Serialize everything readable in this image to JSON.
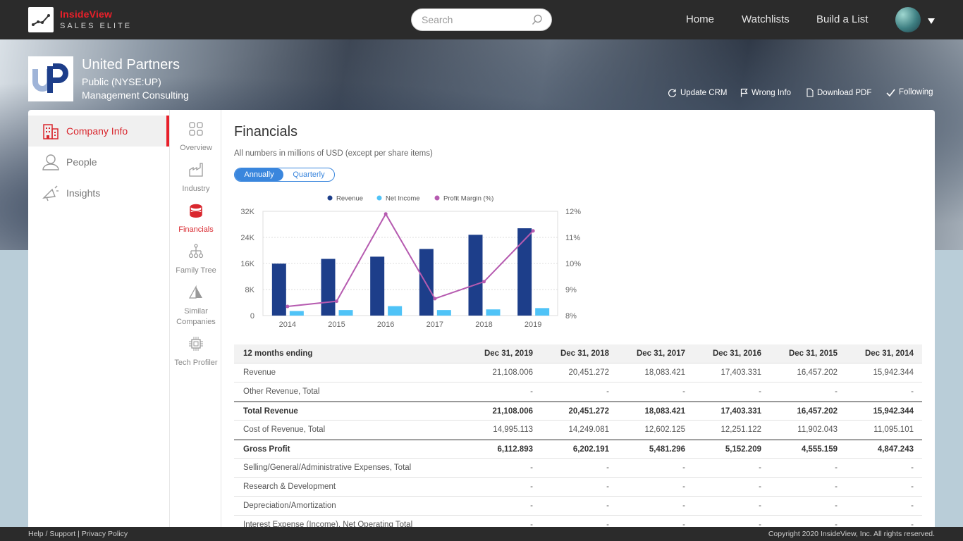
{
  "header": {
    "brand_name": "InsideView",
    "brand_sub": "SALES ELITE",
    "search_placeholder": "Search",
    "nav": [
      "Home",
      "Watchlists",
      "Build a List"
    ]
  },
  "company": {
    "logo_text": "UP",
    "name": "United Partners",
    "listing": "Public (NYSE:UP)",
    "industry": "Management Consulting",
    "actions": [
      "Update CRM",
      "Wrong Info",
      "Download PDF",
      "Following"
    ]
  },
  "left_nav": [
    "Company Info",
    "People",
    "Insights"
  ],
  "sub_nav": [
    "Overview",
    "Industry",
    "Financials",
    "Family Tree",
    "Similar Companies",
    "Tech Profiler"
  ],
  "financials": {
    "title": "Financials",
    "note": "All numbers in millions of USD (except per share items)",
    "toggle": [
      "Annually",
      "Quarterly"
    ],
    "selected": "Annually"
  },
  "chart_data": {
    "type": "bar",
    "categories": [
      "2014",
      "2015",
      "2016",
      "2017",
      "2018",
      "2019"
    ],
    "series": [
      {
        "name": "Revenue",
        "type": "bar",
        "axis": "left",
        "color": "#1d3e8a",
        "values": [
          15942,
          17403,
          18083,
          20451,
          24800,
          26800
        ]
      },
      {
        "name": "Net Income",
        "type": "bar",
        "axis": "left",
        "color": "#4fc3f7",
        "values": [
          1400,
          1700,
          2900,
          1700,
          1900,
          2300
        ]
      },
      {
        "name": "Profit Margin (%)",
        "type": "line",
        "axis": "right",
        "color": "#b65bb0",
        "values": [
          8.35,
          8.55,
          11.9,
          8.65,
          9.3,
          11.25
        ]
      }
    ],
    "y_left": {
      "ticks": [
        "0",
        "8K",
        "16K",
        "24K",
        "32K"
      ],
      "range": [
        0,
        32000
      ]
    },
    "y_right": {
      "ticks": [
        "8%",
        "9%",
        "10%",
        "11%",
        "12%"
      ],
      "range": [
        8,
        12
      ]
    },
    "legend": "top-center",
    "grid": true
  },
  "table": {
    "headers": [
      "12 months ending",
      "Dec 31, 2019",
      "Dec 31, 2018",
      "Dec 31, 2017",
      "Dec 31, 2016",
      "Dec 31, 2015",
      "Dec 31, 2014"
    ],
    "rows": [
      {
        "label": "Revenue",
        "values": [
          "21,108.006",
          "20,451.272",
          "18,083.421",
          "17,403.331",
          "16,457.202",
          "15,942.344"
        ],
        "bold": false
      },
      {
        "label": "Other Revenue, Total",
        "values": [
          "-",
          "-",
          "-",
          "-",
          "-",
          "-"
        ],
        "bold": false
      },
      {
        "label": "Total Revenue",
        "values": [
          "21,108.006",
          "20,451.272",
          "18,083.421",
          "17,403.331",
          "16,457.202",
          "15,942.344"
        ],
        "bold": true
      },
      {
        "label": "Cost of Revenue, Total",
        "values": [
          "14,995.113",
          "14,249.081",
          "12,602.125",
          "12,251.122",
          "11,902.043",
          "11,095.101"
        ],
        "bold": false
      },
      {
        "label": "Gross Profit",
        "values": [
          "6,112.893",
          "6,202.191",
          "5,481.296",
          "5,152.209",
          "4,555.159",
          "4,847.243"
        ],
        "bold": true
      },
      {
        "label": "Selling/General/Administrative Expenses, Total",
        "values": [
          "-",
          "-",
          "-",
          "-",
          "-",
          "-"
        ],
        "bold": false
      },
      {
        "label": "Research & Development",
        "values": [
          "-",
          "-",
          "-",
          "-",
          "-",
          "-"
        ],
        "bold": false
      },
      {
        "label": "Depreciation/Amortization",
        "values": [
          "-",
          "-",
          "-",
          "-",
          "-",
          "-"
        ],
        "bold": false
      },
      {
        "label": "Interest Expense (Income), Net Operating Total",
        "values": [
          "-",
          "-",
          "-",
          "-",
          "-",
          "-"
        ],
        "bold": false
      }
    ]
  },
  "footer": {
    "help": "Help",
    "support": "Support",
    "privacy": "Privacy Policy",
    "copyright": "Copyright 2020 InsideView, Inc. All rights reserved."
  }
}
